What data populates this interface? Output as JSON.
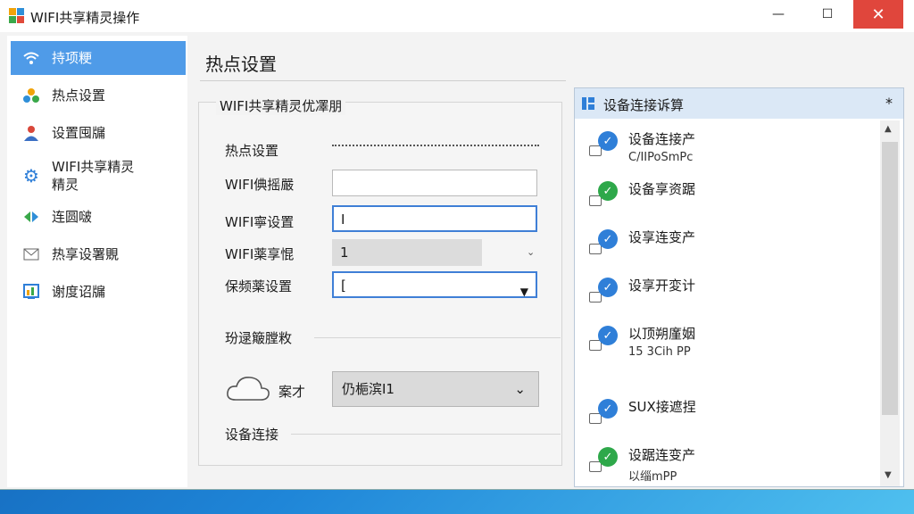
{
  "window": {
    "title": "WIFI共享精灵操作",
    "minimize": "—",
    "maximize": "☐",
    "close": "✕"
  },
  "sidebar": {
    "items": [
      {
        "label": "持项粳",
        "icon": "wifi-icon",
        "active": true
      },
      {
        "label": "热点设置",
        "icon": "dots-icon"
      },
      {
        "label": "设置囤牖",
        "icon": "user-icon"
      },
      {
        "label": "WIFI共享精灵\n精灵",
        "icon": "gear-icon"
      },
      {
        "label": "连圆啵",
        "icon": "arrows-icon"
      },
      {
        "label": "热享设署覞",
        "icon": "mail-icon"
      },
      {
        "label": "谢度诏牖",
        "icon": "report-icon"
      }
    ]
  },
  "main": {
    "title": "热点设置",
    "group_title": "WIFI共享精灵优凙朋",
    "hotspot_label": "热点设置",
    "fields": [
      {
        "label": "WIFI倎摇嚴",
        "value": ""
      },
      {
        "label": "WIFI寧设置",
        "value": "I"
      },
      {
        "label": "WIFI薬享惃",
        "value": "1"
      },
      {
        "label": "保频薬设置",
        "value": "["
      }
    ],
    "section2": "玢逯簸膛敉",
    "dropdown_label": "案才",
    "dropdown_value": "仍梔滨I1",
    "section3": "设备连接"
  },
  "panel": {
    "title": "设备连接诉算",
    "pin": "*",
    "devices": [
      {
        "name": "设备连接产",
        "sub": "C/IIPoSmPc",
        "status": "blue"
      },
      {
        "name": "设备享资踞",
        "sub": "",
        "status": "green"
      },
      {
        "name": "设享连变产",
        "sub": "",
        "status": "blue"
      },
      {
        "name": "设享开変计",
        "sub": "",
        "status": "blue"
      },
      {
        "name": "以顶朔廑姻",
        "sub": "15 3Cih PP",
        "status": "blue"
      },
      {
        "name": "SUX接遮捏",
        "sub": "",
        "status": "blue"
      },
      {
        "name": "设踞连变产",
        "sub": "以缁mPP",
        "status": "green"
      }
    ]
  },
  "colors": {
    "accent": "#4f9be8",
    "badge_blue": "#2f7fd8",
    "badge_green": "#2ea84a",
    "close": "#e0463c"
  }
}
